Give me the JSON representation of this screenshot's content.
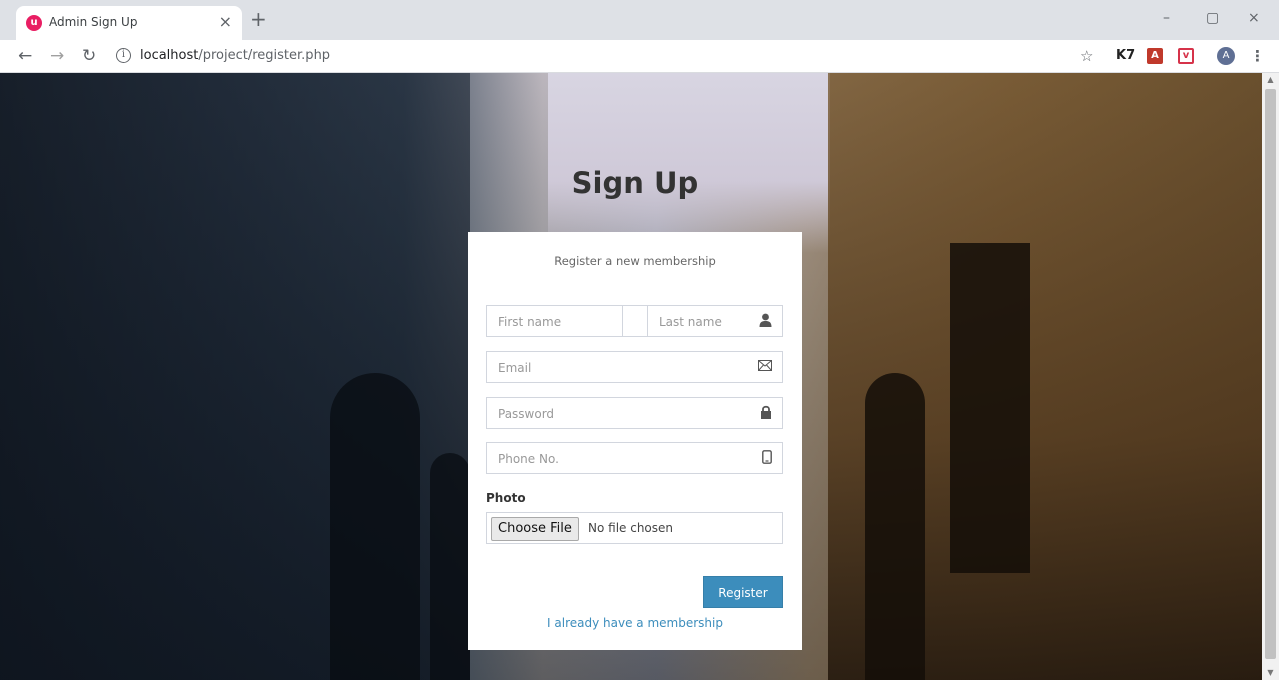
{
  "browser": {
    "tab_title": "Admin Sign Up",
    "tab_close": "×",
    "new_tab": "+",
    "favicon_glyph": "u",
    "url_host": "localhost",
    "url_path": "/project/register.php",
    "avatar_letter": "A",
    "window_minimize": "–",
    "window_restore": "▢",
    "window_close": "×",
    "ext_k7_label": "K7",
    "ext_pdf_label": "A",
    "ext_pocket_label": "v"
  },
  "page": {
    "heading": "Sign Up",
    "message": "Register a new membership",
    "fields": {
      "first_name_placeholder": "First name",
      "last_name_placeholder": "Last name",
      "email_placeholder": "Email",
      "password_placeholder": "Password",
      "phone_placeholder": "Phone No."
    },
    "photo_label": "Photo",
    "choose_file_label": "Choose File",
    "no_file_text": "No file chosen",
    "register_label": "Register",
    "member_link": "I already have a membership"
  },
  "colors": {
    "primary": "#3c8dbc",
    "favicon": "#e91e63"
  },
  "icons": {
    "user": "user-icon",
    "email": "envelope-icon",
    "password": "lock-icon",
    "phone": "phone-icon"
  }
}
